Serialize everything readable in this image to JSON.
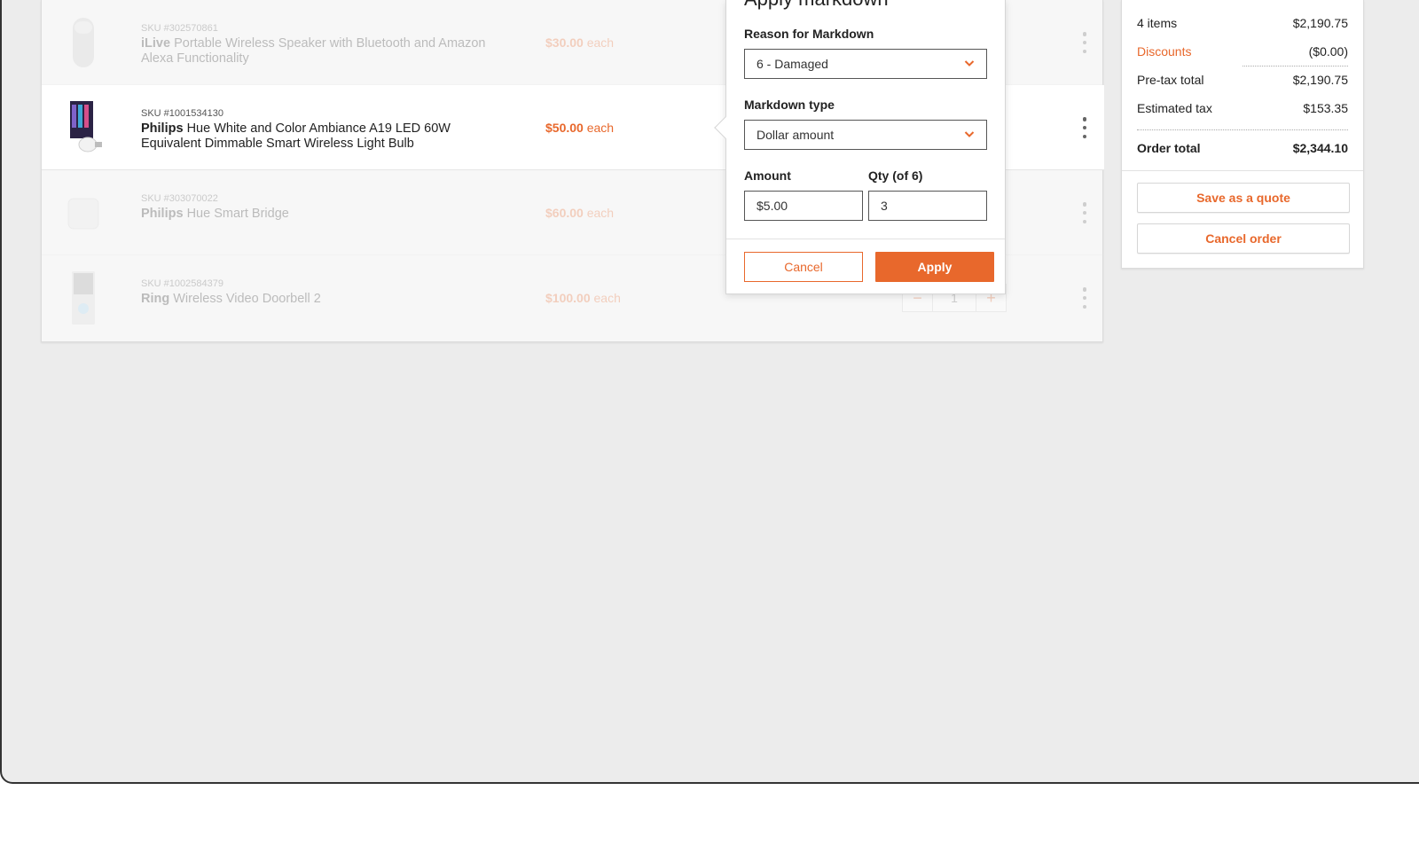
{
  "colors": {
    "accent": "#e8682c",
    "panel": "#ffffff",
    "background": "#ececec"
  },
  "cart": {
    "items": [
      {
        "sku": "SKU #302570861",
        "brand": "iLive",
        "name": "Portable Wireless Speaker with Bluetooth and Amazon Alexa Functionality",
        "price": "$30.00",
        "price_unit": "each",
        "image": "speaker-thumbnail"
      },
      {
        "sku": "SKU #1001534130",
        "brand": "Philips",
        "name": "Hue White and Color Ambiance A19 LED 60W Equivalent Dimmable Smart Wireless Light Bulb",
        "price": "$50.00",
        "price_unit": "each",
        "image": "light-bulb-thumbnail"
      },
      {
        "sku": "SKU #303070022",
        "brand": "Philips",
        "name": "Hue Smart Bridge",
        "price": "$60.00",
        "price_unit": "each",
        "image": "bridge-thumbnail"
      },
      {
        "sku": "SKU #1002584379",
        "brand": "Ring",
        "name": "Wireless Video Doorbell 2",
        "price": "$100.00",
        "price_unit": "each",
        "image": "doorbell-thumbnail",
        "qty": "1",
        "qty_minus": "−",
        "qty_plus": "+"
      }
    ]
  },
  "markdown": {
    "title": "Apply markdown",
    "reason_label": "Reason for Markdown",
    "reason_value": "6 - Damaged",
    "type_label": "Markdown type",
    "type_value": "Dollar amount",
    "amount_label": "Amount",
    "amount_value": "$5.00",
    "qty_label": "Qty (of 6)",
    "qty_value": "3",
    "cancel_label": "Cancel",
    "apply_label": "Apply"
  },
  "summary": {
    "items_label": "4 items",
    "items_value": "$2,190.75",
    "discounts_label": "Discounts",
    "discounts_value": "($0.00)",
    "pretax_label": "Pre-tax total",
    "pretax_value": "$2,190.75",
    "tax_label": "Estimated tax",
    "tax_value": "$153.35",
    "total_label": "Order total",
    "total_value": "$2,344.10",
    "save_quote_label": "Save as a quote",
    "cancel_order_label": "Cancel order"
  }
}
